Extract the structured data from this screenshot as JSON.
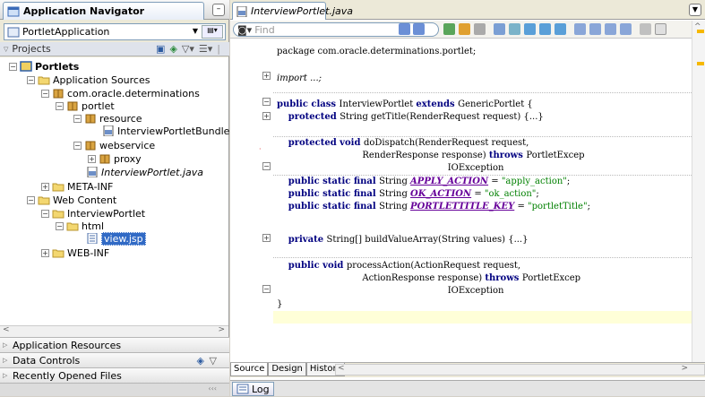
{
  "navigator": {
    "title": "Application Navigator",
    "application": "PortletApplication",
    "projects_label": "Projects"
  },
  "tree": [
    {
      "label": "Portlets",
      "bold": true
    },
    {
      "label": "Application Sources"
    },
    {
      "label": "com.oracle.determinations"
    },
    {
      "label": "portlet"
    },
    {
      "label": "resource"
    },
    {
      "label": "InterviewPortletBundle.java"
    },
    {
      "label": "webservice"
    },
    {
      "label": "proxy"
    },
    {
      "label": "InterviewPortlet.java",
      "italic": true
    },
    {
      "label": "META-INF"
    },
    {
      "label": "Web Content"
    },
    {
      "label": "InterviewPortlet"
    },
    {
      "label": "html"
    },
    {
      "label": "view.jsp",
      "selected": true
    },
    {
      "label": "WEB-INF"
    }
  ],
  "accordion": [
    "Application Resources",
    "Data Controls",
    "Recently Opened Files"
  ],
  "editor": {
    "tab": "InterviewPortlet.java",
    "find_placeholder": "Find",
    "bottom_tabs": [
      "Source",
      "Design",
      "History"
    ],
    "log_tab": "Log"
  },
  "code": [
    {
      "t": [
        [
          "plain",
          "package com.oracle.determinations.portlet;"
        ]
      ]
    },
    {
      "t": [
        [
          "plain",
          "import ...;"
        ]
      ]
    },
    {
      "t": [
        [
          "kw",
          "public class "
        ],
        [
          "plain",
          "InterviewPortlet "
        ],
        [
          "kw",
          "extends "
        ],
        [
          "plain",
          "GenericPortlet {"
        ]
      ]
    },
    {
      "t": [
        [
          "plain",
          "    "
        ],
        [
          "kw",
          "protected "
        ],
        [
          "plain",
          "String getTitle(RenderRequest request) {...}"
        ]
      ]
    },
    {
      "t": [
        [
          "plain",
          "    "
        ],
        [
          "kw",
          "protected void "
        ],
        [
          "plain",
          "doDispatch(RenderRequest request,"
        ]
      ]
    },
    {
      "t": [
        [
          "plain",
          "                              RenderResponse response) "
        ],
        [
          "kw",
          "throws "
        ],
        [
          "plain",
          "PortletExcep"
        ]
      ]
    },
    {
      "t": [
        [
          "plain",
          "                                                            IOException"
        ]
      ]
    },
    {
      "t": [
        [
          "plain",
          "    "
        ],
        [
          "kw",
          "public static final "
        ],
        [
          "plain",
          "String "
        ],
        [
          "fld",
          "APPLY_ACTION"
        ],
        [
          "plain",
          " = "
        ],
        [
          "str",
          "\"apply_action\""
        ],
        [
          "plain",
          ";"
        ]
      ]
    },
    {
      "t": [
        [
          "plain",
          "    "
        ],
        [
          "kw",
          "public static final "
        ],
        [
          "plain",
          "String "
        ],
        [
          "fld",
          "OK_ACTION"
        ],
        [
          "plain",
          " = "
        ],
        [
          "str",
          "\"ok_action\""
        ],
        [
          "plain",
          ";"
        ]
      ]
    },
    {
      "t": [
        [
          "plain",
          "    "
        ],
        [
          "kw",
          "public static final "
        ],
        [
          "plain",
          "String "
        ],
        [
          "fld",
          "PORTLETTITLE_KEY"
        ],
        [
          "plain",
          " = "
        ],
        [
          "str",
          "\"portletTitle\""
        ],
        [
          "plain",
          ";"
        ]
      ]
    },
    {
      "t": [
        [
          "plain",
          "    "
        ],
        [
          "kw",
          "private "
        ],
        [
          "plain",
          "String[] buildValueArray(String values) {...}"
        ]
      ]
    },
    {
      "t": [
        [
          "plain",
          "    "
        ],
        [
          "kw",
          "public void "
        ],
        [
          "plain",
          "processAction(ActionRequest request,"
        ]
      ]
    },
    {
      "t": [
        [
          "plain",
          "                              ActionResponse response) "
        ],
        [
          "kw",
          "throws "
        ],
        [
          "plain",
          "PortletExcep"
        ]
      ]
    },
    {
      "t": [
        [
          "plain",
          "                                                            IOException"
        ]
      ]
    },
    {
      "t": [
        [
          "plain",
          "}"
        ]
      ]
    }
  ],
  "colors": {
    "keyword": "#000080",
    "field": "#660099",
    "string": "#008000",
    "selection": "#316ac5"
  }
}
